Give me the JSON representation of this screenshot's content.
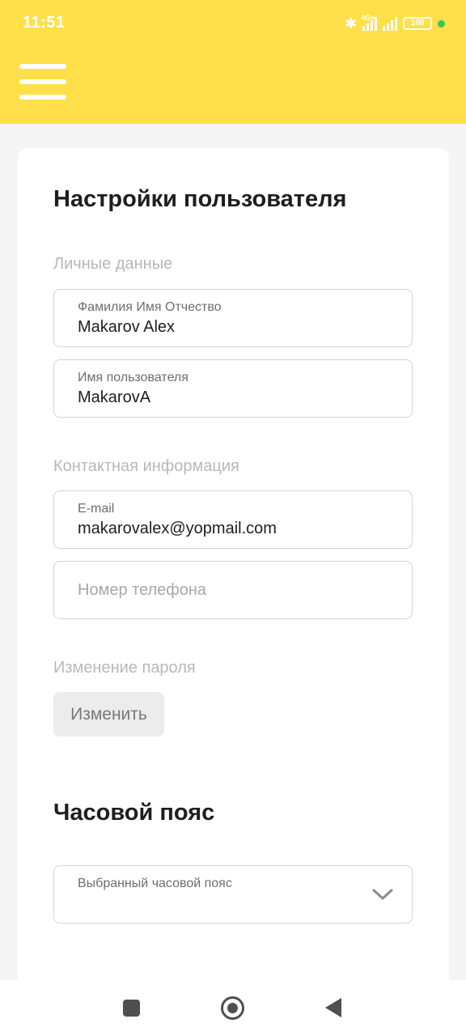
{
  "status_bar": {
    "time": "11:51",
    "network_label": "4G+",
    "battery": "100"
  },
  "header": {
    "menu_icon": "hamburger-menu-icon",
    "background_color": "#ffe04a"
  },
  "user_settings": {
    "title": "Настройки пользователя",
    "personal_section": {
      "label": "Личные данные",
      "full_name": {
        "label": "Фамилия Имя Отчество",
        "value": "Makarov Alex"
      },
      "username": {
        "label": "Имя пользователя",
        "value": "MakarovA"
      }
    },
    "contact_section": {
      "label": "Контактная информация",
      "email": {
        "label": "E-mail",
        "value": "makarovalex@yopmail.com"
      },
      "phone": {
        "placeholder": "Номер телефона",
        "value": ""
      }
    },
    "password_section": {
      "label": "Изменение пароля",
      "change_button": "Изменить"
    }
  },
  "timezone": {
    "title": "Часовой пояс",
    "select": {
      "label": "Выбранный часовой пояс",
      "value": ""
    }
  },
  "navbar": {
    "recents_icon": "square-icon",
    "home_icon": "circle-icon",
    "back_icon": "triangle-back-icon"
  }
}
